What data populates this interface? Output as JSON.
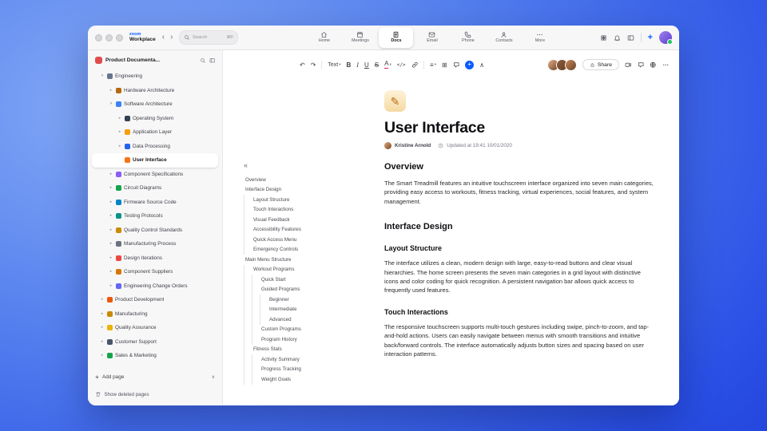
{
  "colors": {
    "accent": "#0b5cff"
  },
  "titlebar": {
    "logo_line1": "zoom",
    "logo_line2": "Workplace",
    "search": {
      "placeholder": "Search",
      "shortcut": "⌘F"
    },
    "tabs": [
      {
        "id": "home",
        "label": "Home",
        "active": false
      },
      {
        "id": "meetings",
        "label": "Meetings",
        "active": false
      },
      {
        "id": "docs",
        "label": "Docs",
        "active": true
      },
      {
        "id": "email",
        "label": "Email",
        "active": false
      },
      {
        "id": "phone",
        "label": "Phone",
        "active": false
      },
      {
        "id": "contacts",
        "label": "Contacts",
        "active": false
      },
      {
        "id": "more",
        "label": "More",
        "active": false
      }
    ]
  },
  "sidebar": {
    "workspace_name": "Product Documenta...",
    "add_page_label": "Add page",
    "show_deleted_label": "Show deleted pages",
    "tree": [
      {
        "label": "Engineering",
        "depth": 0,
        "chevron": "down",
        "icon": "gear",
        "color": "#64748b",
        "selected": false
      },
      {
        "label": "Hardware Architecture",
        "depth": 1,
        "chevron": "right",
        "icon": "wrench",
        "color": "#b4690e",
        "selected": false
      },
      {
        "label": "Software Architecture",
        "depth": 1,
        "chevron": "down",
        "icon": "laptop",
        "color": "#3b82f6",
        "selected": false
      },
      {
        "label": "Operating System",
        "depth": 2,
        "chevron": "right",
        "icon": "terminal",
        "color": "#334155",
        "selected": false
      },
      {
        "label": "Application Layer",
        "depth": 2,
        "chevron": "right",
        "icon": "package",
        "color": "#f59e0b",
        "selected": false
      },
      {
        "label": "Data Processing",
        "depth": 2,
        "chevron": "right",
        "icon": "chart",
        "color": "#2563eb",
        "selected": false
      },
      {
        "label": "User Interface",
        "depth": 2,
        "chevron": "none",
        "icon": "palette",
        "color": "#f97316",
        "selected": true
      },
      {
        "label": "Component Specifications",
        "depth": 1,
        "chevron": "right",
        "icon": "clipboard",
        "color": "#8b5cf6",
        "selected": false
      },
      {
        "label": "Circuit Diagrams",
        "depth": 1,
        "chevron": "right",
        "icon": "plug",
        "color": "#16a34a",
        "selected": false
      },
      {
        "label": "Firmware Source Code",
        "depth": 1,
        "chevron": "right",
        "icon": "floppy-disk",
        "color": "#0284c7",
        "selected": false
      },
      {
        "label": "Testing Protocols",
        "depth": 1,
        "chevron": "right",
        "icon": "flask",
        "color": "#0d9488",
        "selected": false
      },
      {
        "label": "Quality Control Standards",
        "depth": 1,
        "chevron": "right",
        "icon": "medal",
        "color": "#ca8a04",
        "selected": false
      },
      {
        "label": "Manufacturing Process",
        "depth": 1,
        "chevron": "right",
        "icon": "factory",
        "color": "#6b7280",
        "selected": false
      },
      {
        "label": "Design Iterations",
        "depth": 1,
        "chevron": "right",
        "icon": "pencil",
        "color": "#ef4444",
        "selected": false
      },
      {
        "label": "Component Suppliers",
        "depth": 1,
        "chevron": "right",
        "icon": "box",
        "color": "#d97706",
        "selected": false
      },
      {
        "label": "Engineering Change Orders",
        "depth": 1,
        "chevron": "right",
        "icon": "document",
        "color": "#6366f1",
        "selected": false
      },
      {
        "label": "Product Development",
        "depth": 0,
        "chevron": "right",
        "icon": "rocket",
        "color": "#ea580c",
        "selected": false
      },
      {
        "label": "Manufacturing",
        "depth": 0,
        "chevron": "right",
        "icon": "tools",
        "color": "#ca8a04",
        "selected": false
      },
      {
        "label": "Quality Assurance",
        "depth": 0,
        "chevron": "right",
        "icon": "shield",
        "color": "#eab308",
        "selected": false
      },
      {
        "label": "Customer Support",
        "depth": 0,
        "chevron": "right",
        "icon": "chat-bubble",
        "color": "#475569",
        "selected": false
      },
      {
        "label": "Sales & Marketing",
        "depth": 0,
        "chevron": "right",
        "icon": "trend-up",
        "color": "#16a34a",
        "selected": false
      }
    ]
  },
  "editor_toolbar": {
    "text_style_label": "Text",
    "share_label": "Share",
    "left_items": [
      "undo",
      "redo",
      "text-style",
      "bold",
      "italic",
      "underline",
      "strikethrough",
      "text-color",
      "code",
      "link",
      "list",
      "table",
      "comment",
      "insert",
      "collapse"
    ],
    "right_icons": [
      "video",
      "comment",
      "globe",
      "more"
    ],
    "collaborators": [
      "#e8b08a",
      "#8a5a3b",
      "#c98a5e"
    ]
  },
  "outline": {
    "items": [
      {
        "label": "Overview",
        "level": 0
      },
      {
        "label": "Interface Design",
        "level": 0
      },
      {
        "label": "Layout Structure",
        "level": 1
      },
      {
        "label": "Touch Interactions",
        "level": 1
      },
      {
        "label": "Visual Feedback",
        "level": 1
      },
      {
        "label": "Accessibility Features",
        "level": 1
      },
      {
        "label": "Quick Access Menu",
        "level": 1
      },
      {
        "label": "Emergency Controls",
        "level": 1
      },
      {
        "label": "Main Menu Structure",
        "level": 0
      },
      {
        "label": "Workout Programs",
        "level": 1
      },
      {
        "label": "Quick Start",
        "level": 2
      },
      {
        "label": "Guided Programs",
        "level": 2
      },
      {
        "label": "Beginner",
        "level": 3
      },
      {
        "label": "Intermediate",
        "level": 3
      },
      {
        "label": "Advanced",
        "level": 3
      },
      {
        "label": "Custom Programs",
        "level": 2
      },
      {
        "label": "Program History",
        "level": 2
      },
      {
        "label": "Fitness Stats",
        "level": 1
      },
      {
        "label": "Activity Summary",
        "level": 2
      },
      {
        "label": "Progress Tracking",
        "level": 2
      },
      {
        "label": "Weight Goals",
        "level": 2
      }
    ]
  },
  "document": {
    "title": "User Interface",
    "author": "Kristine Arnold",
    "updated": "Updated at 19:41 10/01/2020",
    "sections": [
      {
        "type": "h2",
        "text": "Overview"
      },
      {
        "type": "p",
        "text": "The Smart Treadmill features an intuitive touchscreen interface organized into seven main categories, providing easy access to workouts, fitness tracking, virtual experiences, social features, and system management."
      },
      {
        "type": "h2",
        "text": "Interface Design"
      },
      {
        "type": "h3",
        "text": "Layout Structure"
      },
      {
        "type": "p",
        "text": "The interface utilizes a clean, modern design with large, easy-to-read buttons and clear visual hierarchies. The home screen presents the seven main categories in a grid layout with distinctive icons and color coding for quick recognition. A persistent navigation bar allows quick access to frequently used features."
      },
      {
        "type": "h3",
        "text": "Touch Interactions"
      },
      {
        "type": "p",
        "text": "The responsive touchscreen supports multi-touch gestures including swipe, pinch-to-zoom, and tap-and-hold actions. Users can easily navigate between menus with smooth transitions and intuitive back/forward controls. The interface automatically adjusts button sizes and spacing based on user interaction patterns."
      }
    ]
  }
}
